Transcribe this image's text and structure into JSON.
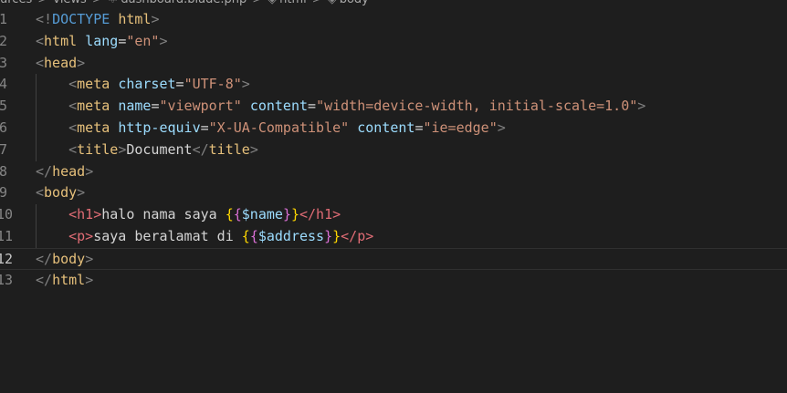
{
  "breadcrumb": {
    "items": [
      "urces",
      "views",
      "dashboard.blade.php",
      "html",
      "body"
    ],
    "separator": ">",
    "icon_file": "blade-file-icon",
    "icon_symbol": "symbol-structure-icon"
  },
  "lines": [
    {
      "num": "1",
      "tokens": [
        [
          "punc",
          "<!"
        ],
        [
          "kw",
          "DOCTYPE"
        ],
        [
          "text",
          " "
        ],
        [
          "tag",
          "html"
        ],
        [
          "punc",
          ">"
        ]
      ]
    },
    {
      "num": "2",
      "tokens": [
        [
          "punc",
          "<"
        ],
        [
          "tag",
          "html"
        ],
        [
          "text",
          " "
        ],
        [
          "attr",
          "lang"
        ],
        [
          "text",
          "="
        ],
        [
          "str",
          "\"en\""
        ],
        [
          "punc",
          ">"
        ]
      ]
    },
    {
      "num": "3",
      "tokens": [
        [
          "punc",
          "<"
        ],
        [
          "tag",
          "head"
        ],
        [
          "punc",
          ">"
        ]
      ]
    },
    {
      "num": "4",
      "indent": true,
      "tokens": [
        [
          "punc",
          "<"
        ],
        [
          "tag",
          "meta"
        ],
        [
          "text",
          " "
        ],
        [
          "attr",
          "charset"
        ],
        [
          "text",
          "="
        ],
        [
          "str",
          "\"UTF-8\""
        ],
        [
          "punc",
          ">"
        ]
      ]
    },
    {
      "num": "5",
      "indent": true,
      "tokens": [
        [
          "punc",
          "<"
        ],
        [
          "tag",
          "meta"
        ],
        [
          "text",
          " "
        ],
        [
          "attr",
          "name"
        ],
        [
          "text",
          "="
        ],
        [
          "str",
          "\"viewport\""
        ],
        [
          "text",
          " "
        ],
        [
          "attr",
          "content"
        ],
        [
          "text",
          "="
        ],
        [
          "str",
          "\"width=device-width, initial-scale=1.0\""
        ],
        [
          "punc",
          ">"
        ]
      ]
    },
    {
      "num": "6",
      "indent": true,
      "tokens": [
        [
          "punc",
          "<"
        ],
        [
          "tag",
          "meta"
        ],
        [
          "text",
          " "
        ],
        [
          "attr",
          "http-equiv"
        ],
        [
          "text",
          "="
        ],
        [
          "str",
          "\"X-UA-Compatible\""
        ],
        [
          "text",
          " "
        ],
        [
          "attr",
          "content"
        ],
        [
          "text",
          "="
        ],
        [
          "str",
          "\"ie=edge\""
        ],
        [
          "punc",
          ">"
        ]
      ]
    },
    {
      "num": "7",
      "indent": true,
      "tokens": [
        [
          "punc",
          "<"
        ],
        [
          "tag",
          "title"
        ],
        [
          "punc",
          ">"
        ],
        [
          "text",
          "Document"
        ],
        [
          "punc",
          "</"
        ],
        [
          "tag",
          "title"
        ],
        [
          "punc",
          ">"
        ]
      ]
    },
    {
      "num": "8",
      "tokens": [
        [
          "punc",
          "</"
        ],
        [
          "tag",
          "head"
        ],
        [
          "punc",
          ">"
        ]
      ]
    },
    {
      "num": "9",
      "tokens": [
        [
          "punc",
          "<"
        ],
        [
          "tag",
          "body"
        ],
        [
          "punc",
          ">"
        ]
      ]
    },
    {
      "num": "10",
      "indent": true,
      "tokens": [
        [
          "tagred",
          "<h1>"
        ],
        [
          "text",
          "halo nama saya "
        ],
        [
          "brace1",
          "{"
        ],
        [
          "brace2",
          "{"
        ],
        [
          "var",
          "$name"
        ],
        [
          "brace2",
          "}"
        ],
        [
          "brace1",
          "}"
        ],
        [
          "tagred",
          "</h1>"
        ]
      ]
    },
    {
      "num": "11",
      "indent": true,
      "tokens": [
        [
          "tagred",
          "<p>"
        ],
        [
          "text",
          "saya beralamat di "
        ],
        [
          "brace1",
          "{"
        ],
        [
          "brace2",
          "{"
        ],
        [
          "var",
          "$address"
        ],
        [
          "brace2",
          "}"
        ],
        [
          "brace1",
          "}"
        ],
        [
          "tagred",
          "</p>"
        ]
      ]
    },
    {
      "num": "12",
      "current": true,
      "tokens": [
        [
          "punc",
          "</"
        ],
        [
          "tag",
          "body"
        ],
        [
          "punc",
          ">"
        ]
      ]
    },
    {
      "num": "13",
      "tokens": [
        [
          "punc",
          "</"
        ],
        [
          "tag",
          "html"
        ],
        [
          "punc",
          ">"
        ]
      ]
    }
  ]
}
